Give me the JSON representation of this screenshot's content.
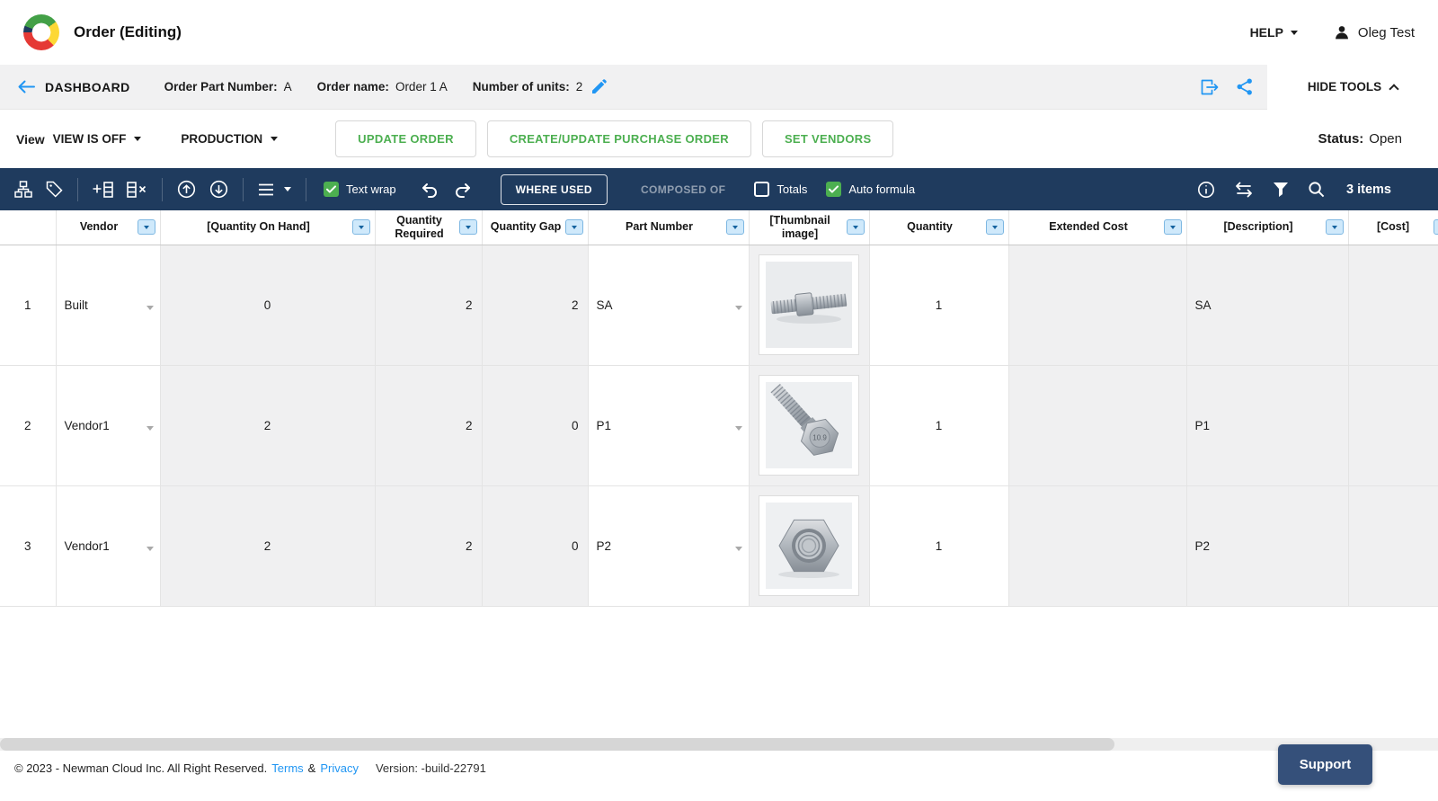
{
  "colors": {
    "accent_blue": "#2196f3",
    "action_green": "#4caf50",
    "toolbar_navy": "#1f3b5e"
  },
  "header": {
    "title": "Order (Editing)",
    "help_label": "HELP",
    "user_name": "Oleg Test"
  },
  "infobar": {
    "dashboard_label": "DASHBOARD",
    "order_part_number_label": "Order Part Number:",
    "order_part_number_value": "A",
    "order_name_label": "Order name:",
    "order_name_value": "Order 1 A",
    "units_label": "Number of units:",
    "units_value": "2",
    "hide_tools_label": "HIDE TOOLS"
  },
  "actions": {
    "view_label": "View",
    "view_state": "VIEW IS OFF",
    "production_label": "PRODUCTION",
    "update_order_label": "UPDATE ORDER",
    "create_po_label": "CREATE/UPDATE PURCHASE ORDER",
    "set_vendors_label": "SET VENDORS",
    "status_label": "Status:",
    "status_value": "Open"
  },
  "toolbar": {
    "text_wrap_label": "Text wrap",
    "where_used_label": "WHERE USED",
    "composed_of_label": "COMPOSED OF",
    "totals_label": "Totals",
    "auto_formula_label": "Auto formula",
    "items_count": "3 items"
  },
  "table": {
    "columns": [
      "Vendor",
      "[Quantity On Hand]",
      "Quantity Required",
      "Quantity Gap",
      "Part Number",
      "[Thumbnail image]",
      "Quantity",
      "Extended Cost",
      "[Description]",
      "[Cost]"
    ],
    "rows": [
      {
        "num": "1",
        "vendor": "Built",
        "qty_on_hand": "0",
        "qty_required": "2",
        "qty_gap": "2",
        "part_number": "SA",
        "thumbnail": "bolt-assembly-photo",
        "quantity": "1",
        "extended_cost": "",
        "description": "SA",
        "cost": ""
      },
      {
        "num": "2",
        "vendor": "Vendor1",
        "qty_on_hand": "2",
        "qty_required": "2",
        "qty_gap": "0",
        "part_number": "P1",
        "thumbnail": "hex-bolt-photo",
        "thumbnail_marking": "10.9",
        "quantity": "1",
        "extended_cost": "",
        "description": "P1",
        "cost": ""
      },
      {
        "num": "3",
        "vendor": "Vendor1",
        "qty_on_hand": "2",
        "qty_required": "2",
        "qty_gap": "0",
        "part_number": "P2",
        "thumbnail": "hex-nut-photo",
        "quantity": "1",
        "extended_cost": "",
        "description": "P2",
        "cost": ""
      }
    ]
  },
  "footer": {
    "copyright": "© 2023 - Newman Cloud Inc. All Right Reserved.",
    "terms_label": "Terms",
    "ampersand": "&",
    "privacy_label": "Privacy",
    "version": "Version: -build-22791",
    "support_label": "Support"
  }
}
